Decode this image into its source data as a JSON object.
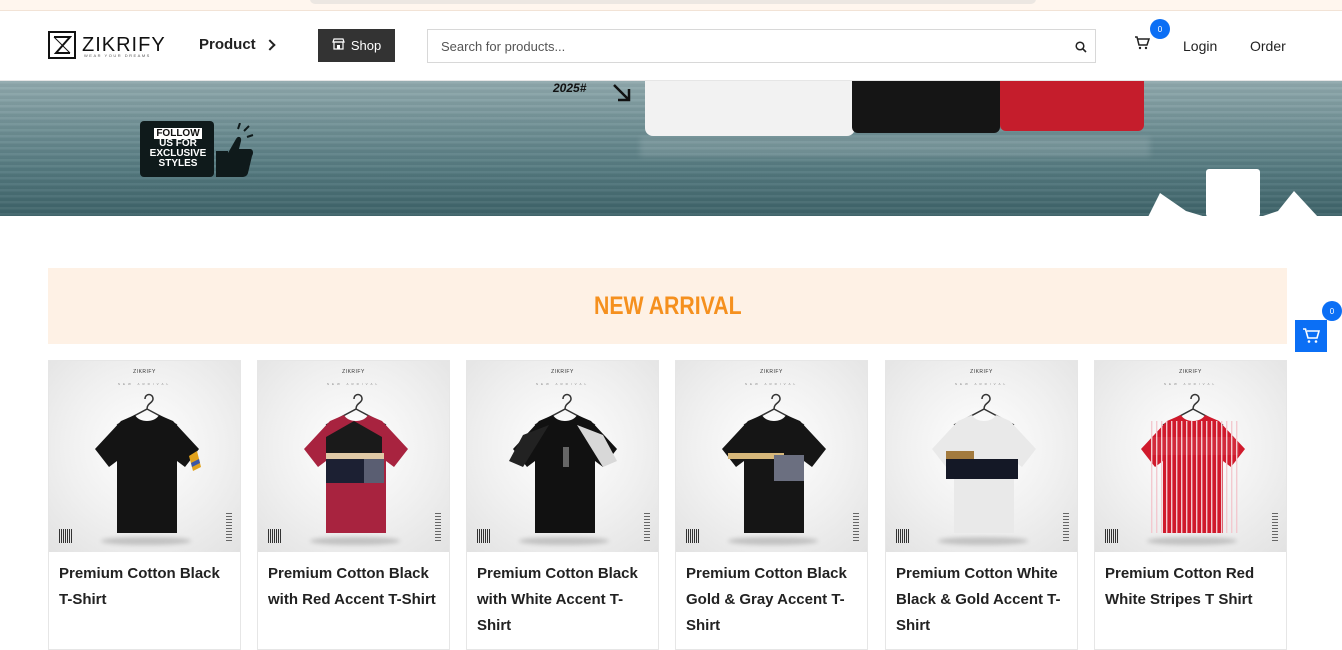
{
  "header": {
    "logo_text": "ZIKRIFY",
    "logo_tagline": "WEAR YOUR DREAMS",
    "nav_product": "Product",
    "shop_label": "Shop",
    "search_placeholder": "Search for products...",
    "cart_count": "0",
    "login_label": "Login",
    "order_label": "Order"
  },
  "banner": {
    "follow_line1": "FOLLOW",
    "follow_line2": "US FOR",
    "follow_line3": "EXCLUSIVE",
    "follow_line4": "STYLES",
    "year_text": "2025#"
  },
  "section": {
    "title": "NEW ARRIVAL"
  },
  "floating_cart": {
    "count": "0"
  },
  "card_brand": "ZIKRIFY",
  "card_sub": "NEW ARRIVAL",
  "products": [
    {
      "title": "Premium Cotton Black T-Shirt",
      "shirt_color": "#141414",
      "accent": "lawston"
    },
    {
      "title": "Premium Cotton Black with Red Accent T-Shirt",
      "shirt_color": "#a8233f",
      "accent": "red-block"
    },
    {
      "title": "Premium Cotton Black with White Accent T-Shirt",
      "shirt_color": "#111111",
      "accent": "white-shoulder"
    },
    {
      "title": "Premium Cotton Black Gold & Gray Accent T-Shirt",
      "shirt_color": "#151515",
      "accent": "gold-gray"
    },
    {
      "title": "Premium Cotton White Black & Gold Accent T-Shirt",
      "shirt_color": "#e9e9e9",
      "accent": "black-gold"
    },
    {
      "title": "Premium Cotton Red White Stripes T Shirt",
      "shirt_color": "#d01a2c",
      "accent": "stripes"
    }
  ],
  "colors": {
    "accent_orange": "#f5901e",
    "arrival_bg": "#fef1e5",
    "brand_blue": "#0b6ff5",
    "shop_bg": "#333333"
  }
}
